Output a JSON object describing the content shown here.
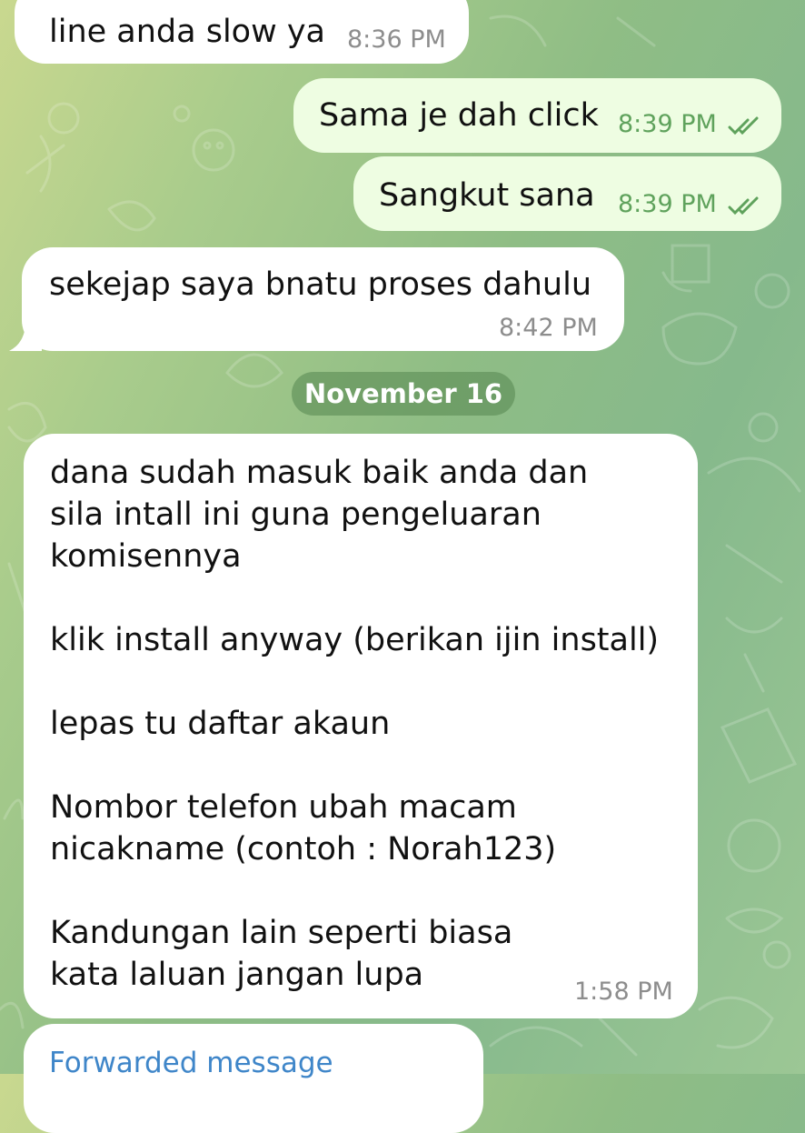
{
  "messages": [
    {
      "text": "line anda slow ya",
      "time": "8:36 PM"
    },
    {
      "text": "Sama je dah click",
      "time": "8:39 PM"
    },
    {
      "text": "Sangkut sana",
      "time": "8:39 PM"
    },
    {
      "text": "sekejap saya bnatu proses dahulu",
      "time": "8:42 PM"
    }
  ],
  "date_separator": "November 16",
  "long_message": {
    "lines": [
      "dana sudah masuk baik anda dan",
      "sila intall ini guna pengeluaran",
      "komisennya",
      "",
      "klik install anyway (berikan ijin install)",
      "",
      "lepas tu daftar akaun",
      "",
      "Nombor telefon ubah macam",
      "nicakname (contoh : Norah123)",
      "",
      "Kandungan lain seperti biasa",
      "kata laluan jangan lupa"
    ],
    "time": "1:58 PM"
  },
  "forwarded": {
    "label": "Forwarded message"
  },
  "icons": {
    "read_status": "double-check-icon"
  },
  "colors": {
    "incoming_bubble": "#ffffff",
    "outgoing_bubble": "#eefde2",
    "outgoing_meta": "#5fa25c",
    "forward_link": "#3f86c9"
  }
}
